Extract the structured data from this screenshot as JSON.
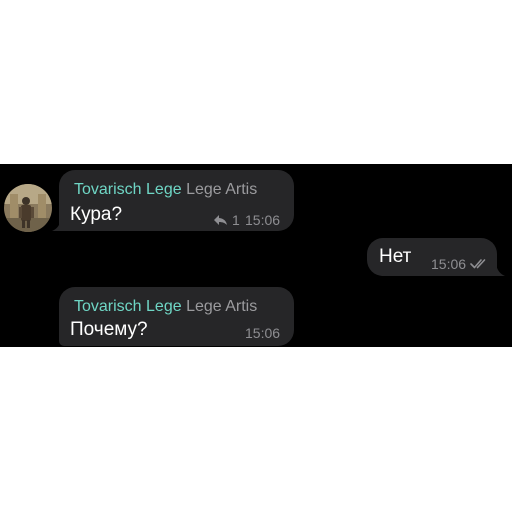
{
  "messages": [
    {
      "sender_name": "Tovarisch Lege",
      "sender_title": "Lege Artis",
      "text": "Кура?",
      "reply_count": "1",
      "time": "15:06"
    },
    {
      "text": "Нет",
      "time": "15:06"
    },
    {
      "sender_name": "Tovarisch Lege",
      "sender_title": "Lege Artis",
      "text": "Почему?",
      "time": "15:06"
    }
  ],
  "colors": {
    "chat_background": "#000000",
    "bubble": "#262628",
    "sender_name": "#6fd6c5",
    "meta": "#8e8e92"
  },
  "icons": {
    "reply": "reply-arrow-icon",
    "read_status": "double-check-icon"
  }
}
